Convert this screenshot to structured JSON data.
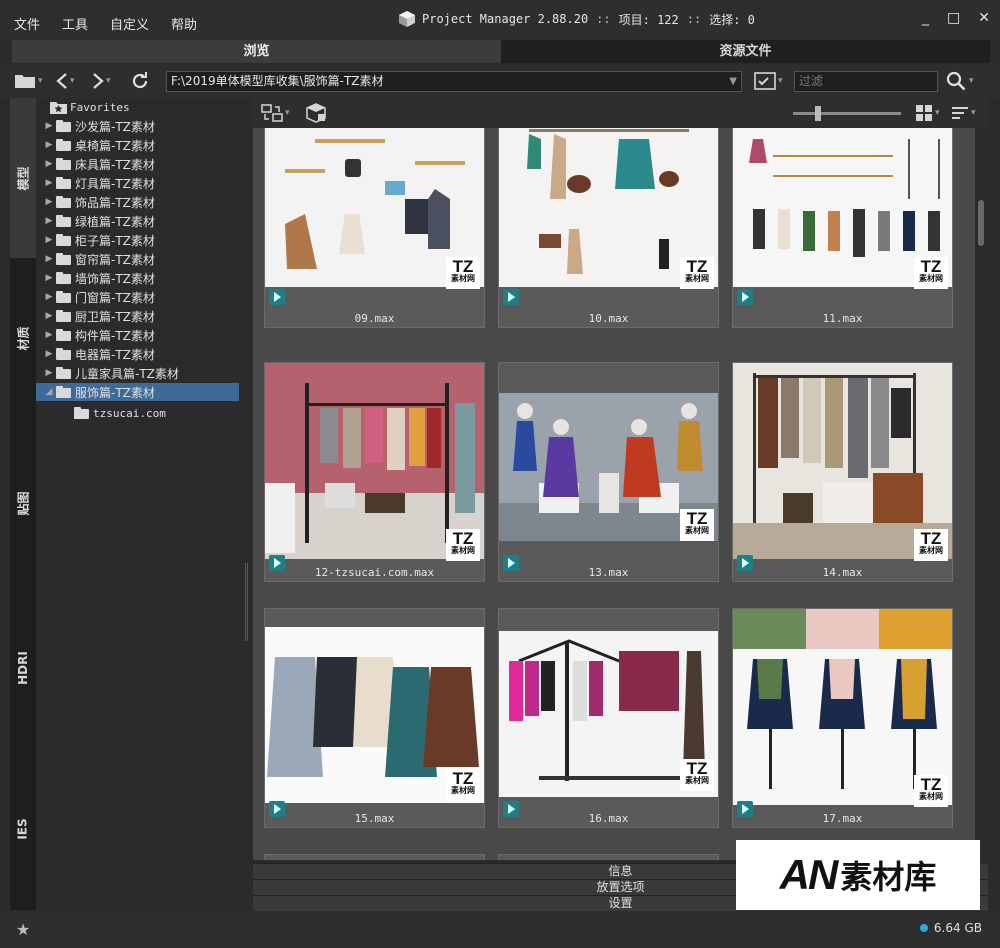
{
  "menu": [
    "文件",
    "工具",
    "自定义",
    "帮助"
  ],
  "titlebar": {
    "app": "Project Manager 2.88.20",
    "sep": "::",
    "items_label": "项目: 122",
    "selection_label": "选择: 0"
  },
  "window_buttons": [
    "_",
    "□",
    "✕"
  ],
  "tabs": [
    {
      "label": "浏览",
      "active": true
    },
    {
      "label": "资源文件",
      "active": false
    }
  ],
  "nav": {
    "path": "F:\\2019单体模型库收集\\服饰篇-TZ素材",
    "filter_placeholder": "过滤"
  },
  "vtabs": [
    "模型",
    "材质",
    "贴图",
    "HDRI",
    "IES"
  ],
  "tree": {
    "favorites": "Favorites",
    "items": [
      "沙发篇-TZ素材",
      "桌椅篇-TZ素材",
      "床具篇-TZ素材",
      "灯具篇-TZ素材",
      "饰品篇-TZ素材",
      "绿植篇-TZ素材",
      "柜子篇-TZ素材",
      "窗帘篇-TZ素材",
      "墙饰篇-TZ素材",
      "门窗篇-TZ素材",
      "厨卫篇-TZ素材",
      "构件篇-TZ素材",
      "电器篇-TZ素材",
      "儿童家具篇-TZ素材",
      "服饰篇-TZ素材"
    ],
    "selected_index": 14,
    "child": "tzsucai.com"
  },
  "thumbs": [
    {
      "caption": "09.max"
    },
    {
      "caption": "10.max"
    },
    {
      "caption": "11.max"
    },
    {
      "caption": "12-tzsucai.com.max"
    },
    {
      "caption": "13.max"
    },
    {
      "caption": "14.max"
    },
    {
      "caption": "15.max"
    },
    {
      "caption": "16.max"
    },
    {
      "caption": "17.max"
    }
  ],
  "badge": {
    "tz": "TZ",
    "sub": "素材网"
  },
  "bottom_panels": [
    "信息",
    "放置选项",
    "设置"
  ],
  "status": {
    "disk": "6.64 GB"
  },
  "watermark": {
    "an": "AN",
    "cn": "素材库"
  },
  "colors": {
    "selection": "#3d6a99",
    "disk_dot": "#2ea8e0",
    "max_icon": "#1f7f86"
  }
}
